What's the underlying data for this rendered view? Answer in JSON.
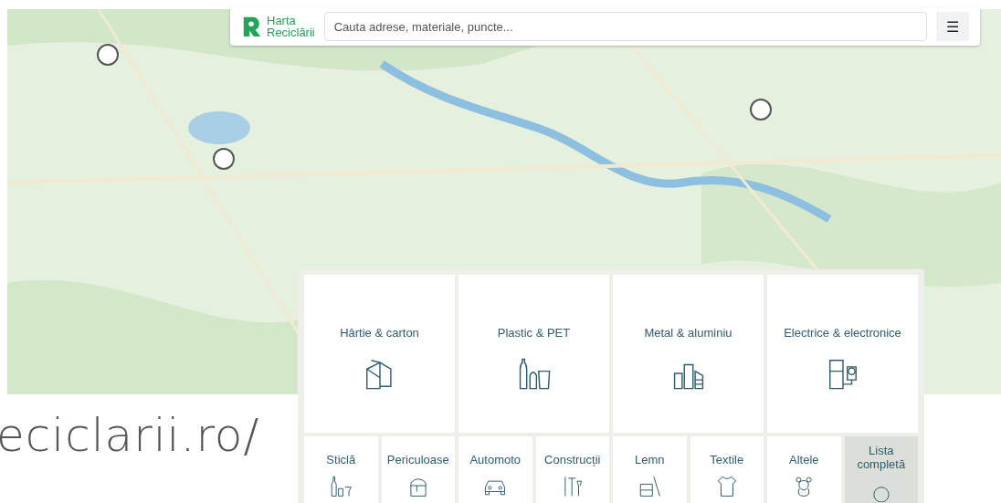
{
  "header": {
    "logo_line_1": "Harta",
    "logo_line_2": "Reciclării",
    "search": {
      "placeholder": "Cauta adrese, materiale, puncte..."
    },
    "menu_glyph": "☰"
  },
  "categories": [
    {
      "label": "Hârtie & carton",
      "kind": "large"
    },
    {
      "label": "Plastic & PET",
      "kind": "large"
    },
    {
      "label": "Metal & aluminiu",
      "kind": "large"
    },
    {
      "label": "Electrice & electronice",
      "kind": "large"
    },
    {
      "label": "Sticlă",
      "kind": "small"
    },
    {
      "label": "Periculoase",
      "kind": "small"
    },
    {
      "label": "Automoto",
      "kind": "small"
    },
    {
      "label": "Construcții",
      "kind": "small"
    },
    {
      "label": "Lemn",
      "kind": "small"
    },
    {
      "label": "Textile",
      "kind": "small"
    },
    {
      "label": "Altele",
      "kind": "small"
    },
    {
      "label": "Lista completă",
      "kind": "full-list"
    }
  ],
  "url_text": "eciclarii.ro/"
}
